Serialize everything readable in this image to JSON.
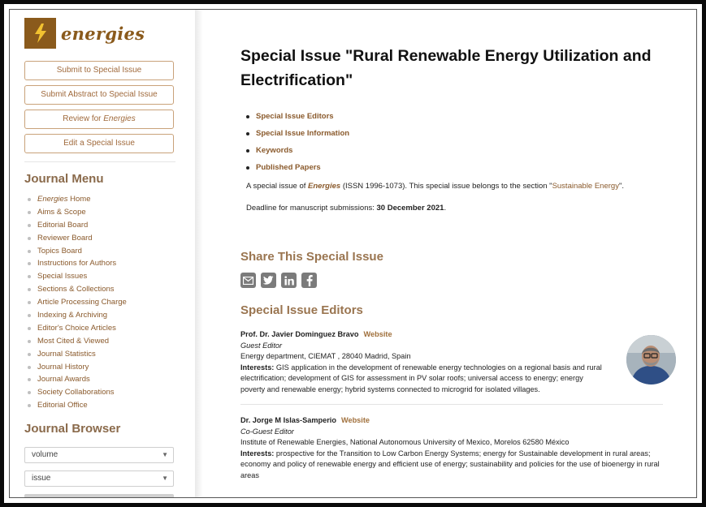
{
  "journal": {
    "name": "energies"
  },
  "sidebar": {
    "buttons": {
      "submit": "Submit to Special Issue",
      "submit_abstract": "Submit Abstract to Special Issue",
      "review_prefix": "Review for ",
      "review_journal": "Energies",
      "edit": "Edit a Special Issue"
    },
    "journal_menu_title": "Journal Menu",
    "menu": {
      "home_journal": "Energies",
      "home_suffix": " Home",
      "items": [
        "Aims & Scope",
        "Editorial Board",
        "Reviewer Board",
        "Topics Board",
        "Instructions for Authors",
        "Special Issues",
        "Sections & Collections",
        "Article Processing Charge",
        "Indexing & Archiving",
        "Editor's Choice Articles",
        "Most Cited & Viewed",
        "Journal Statistics",
        "Journal History",
        "Journal Awards",
        "Society Collaborations",
        "Editorial Office"
      ]
    },
    "journal_browser_title": "Journal Browser",
    "volume_select": "volume",
    "issue_select": "issue"
  },
  "main": {
    "title": "Special Issue \"Rural Renewable Energy Utilization and Electrification\"",
    "toc": [
      "Special Issue Editors",
      "Special Issue Information",
      "Keywords",
      "Published Papers"
    ],
    "intro": {
      "prefix": "A special issue of ",
      "journal": "Energies",
      "middle": " (ISSN 1996-1073). This special issue belongs to the section \"",
      "section": "Sustainable Energy",
      "suffix": "\"."
    },
    "deadline": {
      "label": "Deadline for manuscript submissions: ",
      "date": "30 December 2021",
      "suffix": "."
    },
    "share_title": "Share This Special Issue",
    "editors_title": "Special Issue Editors",
    "editors": [
      {
        "name": "Prof. Dr. Javier Dominguez Bravo",
        "website": "Website",
        "role": "Guest Editor",
        "affiliation": "Energy department, CIEMAT , 28040 Madrid, Spain",
        "interests_label": "Interests:",
        "interests": " GIS application in the development of renewable energy technologies on a regional basis and rural electrification; development of GIS for assessment in PV solar roofs; universal access to energy; energy poverty and renewable energy; hybrid systems connected to microgrid for isolated villages."
      },
      {
        "name": "Dr. Jorge M Islas-Samperio",
        "website": "Website",
        "role": "Co-Guest Editor",
        "affiliation": "Institute of Renewable Energies, National Autonomous University of Mexico, Morelos 62580 México",
        "interests_label": "Interests:",
        "interests": " prospective for the Transition to Low Carbon Energy Systems; energy for Sustainable development in rural areas; economy and policy of renewable energy and efficient use of energy; sustainability and policies for the use of bioenergy in rural areas"
      }
    ]
  },
  "colors": {
    "brand": "#8a5a1c",
    "link": "#8a5a2c",
    "heading": "#9a7550",
    "icon": "#7b7b7b"
  },
  "icons": [
    "lightning-logo-icon",
    "email-share-icon",
    "twitter-share-icon",
    "linkedin-share-icon",
    "facebook-share-icon",
    "dropdown-arrow-icon"
  ]
}
